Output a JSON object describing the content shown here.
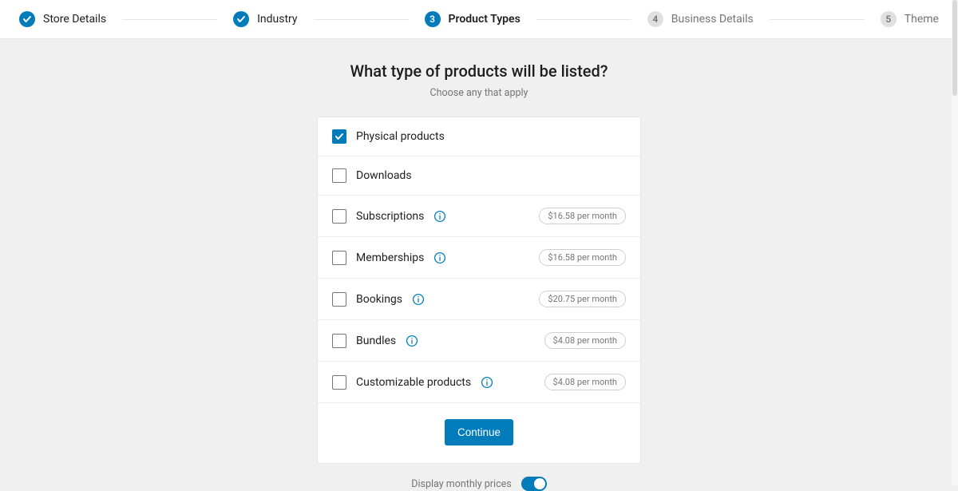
{
  "stepper": {
    "steps": [
      {
        "label": "Store Details",
        "state": "done",
        "num": ""
      },
      {
        "label": "Industry",
        "state": "done",
        "num": ""
      },
      {
        "label": "Product Types",
        "state": "current",
        "num": "3"
      },
      {
        "label": "Business Details",
        "state": "upcoming",
        "num": "4"
      },
      {
        "label": "Theme",
        "state": "upcoming",
        "num": "5"
      }
    ]
  },
  "heading": "What type of products will be listed?",
  "subheading": "Choose any that apply",
  "options": [
    {
      "label": "Physical products",
      "checked": true,
      "info": false,
      "price": ""
    },
    {
      "label": "Downloads",
      "checked": false,
      "info": false,
      "price": ""
    },
    {
      "label": "Subscriptions",
      "checked": false,
      "info": true,
      "price": "$16.58 per month"
    },
    {
      "label": "Memberships",
      "checked": false,
      "info": true,
      "price": "$16.58 per month"
    },
    {
      "label": "Bookings",
      "checked": false,
      "info": true,
      "price": "$20.75 per month"
    },
    {
      "label": "Bundles",
      "checked": false,
      "info": true,
      "price": "$4.08 per month"
    },
    {
      "label": "Customizable products",
      "checked": false,
      "info": true,
      "price": "$4.08 per month"
    }
  ],
  "continue_label": "Continue",
  "toggle": {
    "label": "Display monthly prices",
    "on": true
  },
  "colors": {
    "primary": "#007cba",
    "muted": "#757575",
    "border": "#e5e5e5"
  }
}
